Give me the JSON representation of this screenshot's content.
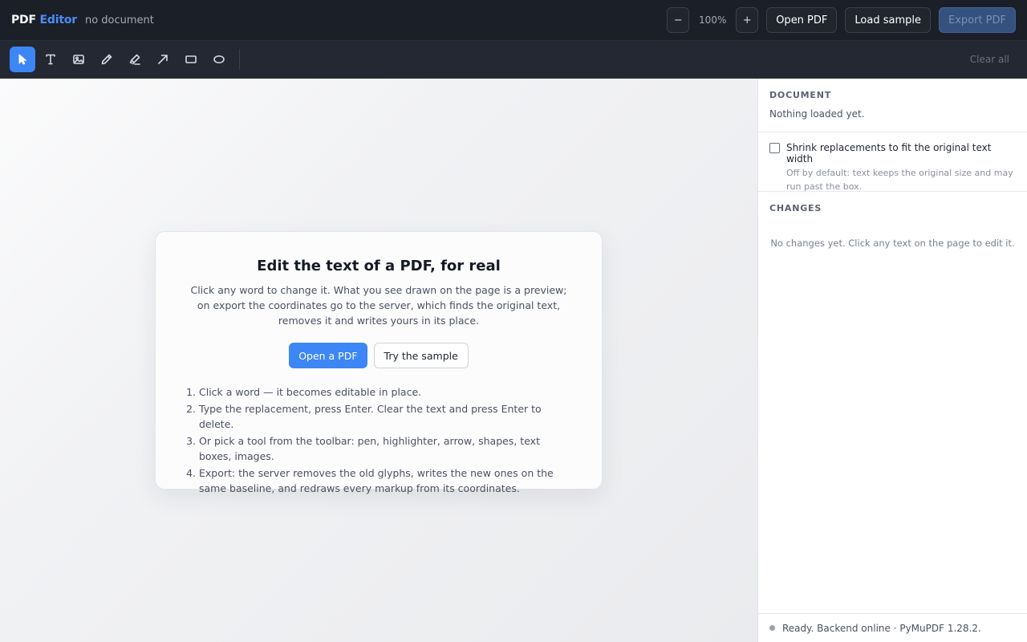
{
  "app": {
    "brand_primary": "PDF",
    "brand_accent": "Editor",
    "document_name": "no document"
  },
  "topbar": {
    "zoom_out_label": "−",
    "zoom_level": "100%",
    "zoom_in_label": "+",
    "open_pdf_label": "Open PDF",
    "load_sample_label": "Load sample",
    "export_pdf_label": "Export PDF"
  },
  "toolbar": {
    "tools": [
      {
        "name": "select",
        "icon": "cursor-icon",
        "active": true
      },
      {
        "name": "text",
        "icon": "text-icon",
        "active": false
      },
      {
        "name": "image",
        "icon": "image-icon",
        "active": false
      },
      {
        "name": "pen",
        "icon": "pen-icon",
        "active": false
      },
      {
        "name": "highlighter",
        "icon": "highlighter-icon",
        "active": false
      },
      {
        "name": "arrow",
        "icon": "arrow-icon",
        "active": false
      },
      {
        "name": "rectangle",
        "icon": "rectangle-icon",
        "active": false
      },
      {
        "name": "ellipse",
        "icon": "ellipse-icon",
        "active": false
      }
    ],
    "clear_all_label": "Clear all"
  },
  "welcome": {
    "title": "Edit the text of a PDF, for real",
    "description": "Click any word to change it. What you see drawn on the page is a preview; on export the coordinates go to the server, which finds the original text, removes it and writes yours in its place.",
    "open_button": "Open a PDF",
    "sample_button": "Try the sample",
    "steps": [
      "Click a word — it becomes editable in place.",
      "Type the replacement, press Enter. Clear the text and press Enter to delete.",
      "Or pick a tool from the toolbar: pen, highlighter, arrow, shapes, text boxes, images.",
      "Export: the server removes the old glyphs, writes the new ones on the same baseline, and redraws every markup from its coordinates."
    ]
  },
  "panel": {
    "document_heading": "DOCUMENT",
    "document_text": "Nothing loaded yet.",
    "shrink_label": "Shrink replacements to fit the original text width",
    "shrink_hint": "Off by default: text keeps the original size and may run past the box.",
    "shrink_checked": false,
    "changes_heading": "CHANGES",
    "changes_empty": "No changes yet. Click any text on the page to edit it.",
    "status_text": "Ready. Backend online · PyMuPDF 1.28.2."
  },
  "colors": {
    "accent": "#3d86f5",
    "topbar_bg": "#1b1f27",
    "toolbar_bg": "#232832"
  }
}
